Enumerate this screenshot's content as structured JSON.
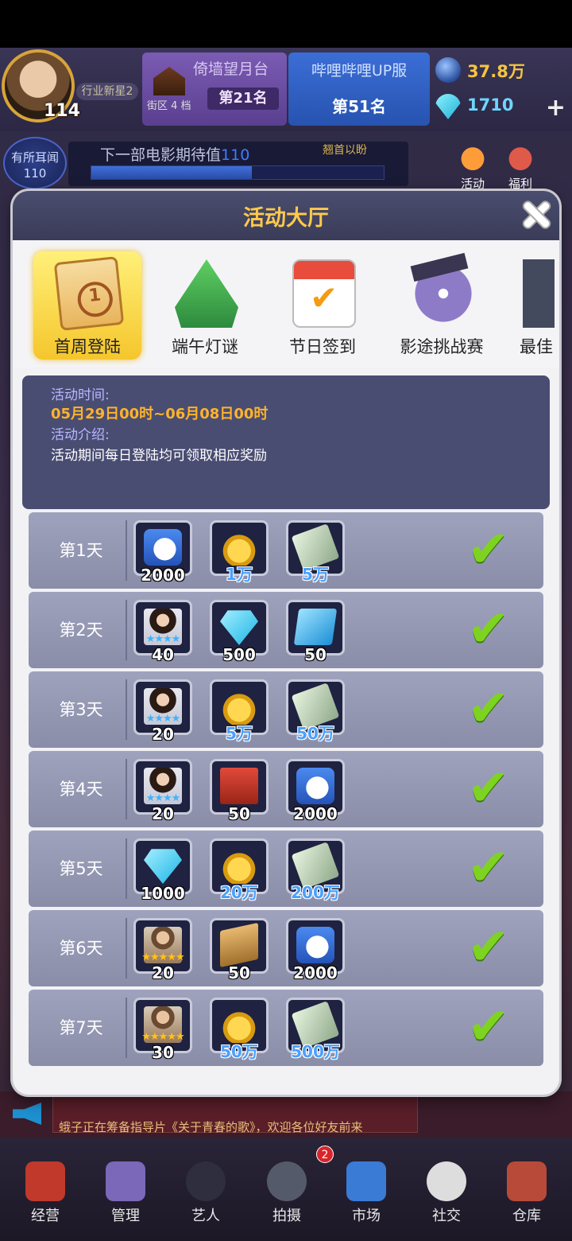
{
  "hud": {
    "level": "114",
    "title_badge": "行业新星2",
    "rank1": {
      "name": "倚墙望月台",
      "district": "街区 4 档",
      "rank": "第21名"
    },
    "rank2": {
      "name": "哔哩哔哩UP服",
      "rank": "第51名"
    },
    "gold": "37.8万",
    "diamond": "1710",
    "rumor": "有所耳闻",
    "rumor_value": "110",
    "expect_label": "下一部电影期待值",
    "expect_value": "110",
    "expect_hint": "翘首以盼",
    "expect_progress": 0.55,
    "top_tabs": [
      "活动",
      "福利"
    ]
  },
  "dialog": {
    "title": "活动大厅",
    "tabs": [
      {
        "label": "首周登陆",
        "icon": "calendar-day-icon",
        "active": true
      },
      {
        "label": "端午灯谜",
        "icon": "zongzi-icon"
      },
      {
        "label": "节日签到",
        "icon": "calendar-check-icon"
      },
      {
        "label": "影途挑战赛",
        "icon": "film-reel-icon"
      },
      {
        "label": "最佳",
        "icon": "clapperboard-icon"
      }
    ],
    "info": {
      "time_label": "活动时间:",
      "time_value": "05月29日00时~06月08日00时",
      "desc_label": "活动介绍:",
      "desc_value": "活动期间每日登陆均可领取相应奖励"
    },
    "rows": [
      {
        "day": "第1天",
        "rewards": [
          {
            "icon": "like-icon",
            "qty": "2000",
            "blue": false
          },
          {
            "icon": "coin-icon",
            "qty": "1万",
            "blue": true
          },
          {
            "icon": "cash-icon",
            "qty": "5万",
            "blue": true
          }
        ]
      },
      {
        "day": "第2天",
        "rewards": [
          {
            "icon": "female-artist-card-icon",
            "qty": "40",
            "stars": "★★★★",
            "star_color": "blue"
          },
          {
            "icon": "diamond-icon",
            "qty": "500",
            "blue": false
          },
          {
            "icon": "card-icon",
            "qty": "50",
            "blue": false
          }
        ]
      },
      {
        "day": "第3天",
        "rewards": [
          {
            "icon": "female-artist-card-icon",
            "qty": "20",
            "stars": "★★★★",
            "star_color": "blue"
          },
          {
            "icon": "coin-icon",
            "qty": "5万",
            "blue": true
          },
          {
            "icon": "cash-icon",
            "qty": "50万",
            "blue": true
          }
        ]
      },
      {
        "day": "第4天",
        "rewards": [
          {
            "icon": "female-artist-card-icon",
            "qty": "20",
            "stars": "★★★★",
            "star_color": "blue"
          },
          {
            "icon": "brick-icon",
            "qty": "50",
            "blue": false
          },
          {
            "icon": "like-icon",
            "qty": "2000",
            "blue": false
          }
        ]
      },
      {
        "day": "第5天",
        "rewards": [
          {
            "icon": "diamond-icon",
            "qty": "1000",
            "blue": false
          },
          {
            "icon": "coin-icon",
            "qty": "20万",
            "blue": true
          },
          {
            "icon": "cash-icon",
            "qty": "200万",
            "blue": true
          }
        ]
      },
      {
        "day": "第6天",
        "rewards": [
          {
            "icon": "male-artist-card-icon",
            "qty": "20",
            "stars": "★★★★★",
            "star_color": "gold"
          },
          {
            "icon": "wood-icon",
            "qty": "50",
            "blue": false
          },
          {
            "icon": "like-icon",
            "qty": "2000",
            "blue": false
          }
        ]
      },
      {
        "day": "第7天",
        "rewards": [
          {
            "icon": "male-artist-card-icon",
            "qty": "30",
            "stars": "★★★★★",
            "star_color": "gold"
          },
          {
            "icon": "coin-icon",
            "qty": "50万",
            "blue": true
          },
          {
            "icon": "cash-icon",
            "qty": "500万",
            "blue": true
          }
        ]
      }
    ]
  },
  "ticker": {
    "message": "蛾子正在筹备指导片《关于青春的歌》，欢迎各位好友前来"
  },
  "nav": {
    "items": [
      "经营",
      "管理",
      "艺人",
      "拍摄",
      "市场",
      "社交",
      "仓库"
    ],
    "shoot_badge": "2"
  },
  "colors": {
    "accent_gold": "#ffc94a",
    "check_green": "#7ed321",
    "info_bg": "#4a4d72",
    "time_orange": "#ffb32a"
  }
}
